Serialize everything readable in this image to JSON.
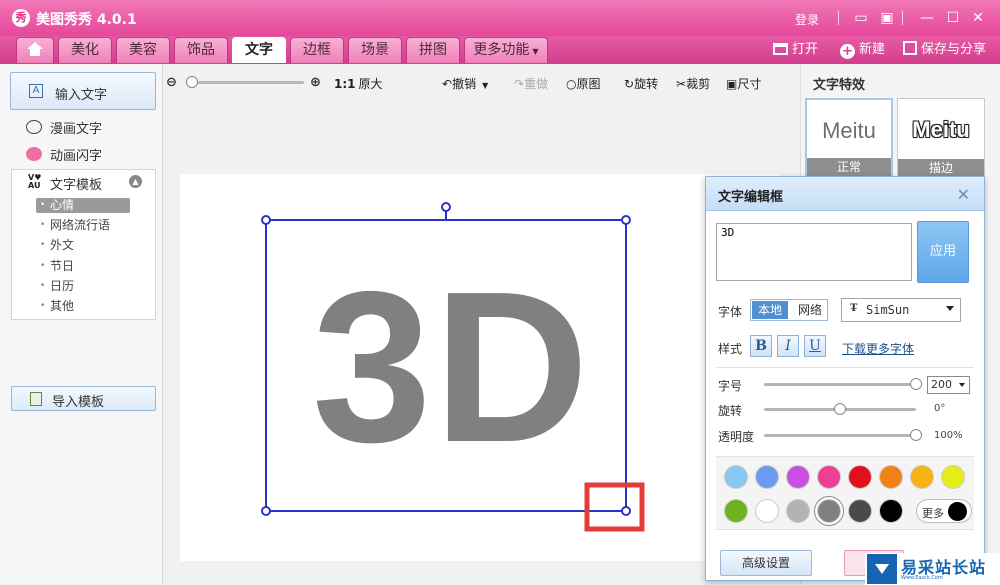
{
  "app": {
    "title": "美图秀秀 4.0.1",
    "logo_text": "秀",
    "login": "登录"
  },
  "titlebar": {
    "feedback_icon": "chat-icon",
    "skin_icon": "skin-icon"
  },
  "tabs": [
    {
      "label": "",
      "icon": "home-icon"
    },
    {
      "label": "美化"
    },
    {
      "label": "美容"
    },
    {
      "label": "饰品"
    },
    {
      "label": "文字",
      "active": true
    },
    {
      "label": "边框"
    },
    {
      "label": "场景"
    },
    {
      "label": "拼图"
    },
    {
      "label": "更多功能"
    }
  ],
  "menu_right": {
    "open": "打开",
    "new": "新建",
    "save": "保存与分享"
  },
  "left_panel": {
    "input_text": "输入文字",
    "comic_text": "漫画文字",
    "animated_text": "动画闪字",
    "template_header": "文字模板",
    "template_items": [
      "心情",
      "网络流行语",
      "外文",
      "节日",
      "日历",
      "其他"
    ],
    "selected_template": "心情",
    "import_template": "导入模板"
  },
  "toolbar": {
    "actual_size_key": "1:1",
    "actual_size": "原大",
    "undo": "撤销",
    "redo": "重做",
    "original": "原图",
    "rotate": "旋转",
    "crop": "裁剪",
    "resize": "尺寸"
  },
  "canvas": {
    "text": "3D"
  },
  "effects": {
    "title": "文字特效",
    "cards": [
      {
        "sample": "Meitu",
        "label": "正常",
        "active": true
      },
      {
        "sample": "Meitu",
        "label": "描边",
        "active": false
      }
    ]
  },
  "editor": {
    "title": "文字编辑框",
    "text_value": "3D",
    "apply": "应用",
    "font_label": "字体",
    "font_local": "本地",
    "font_web": "网络",
    "font_name": "SimSun",
    "style_label": "样式",
    "bold": "B",
    "italic": "I",
    "underline": "U",
    "download_fonts": "下载更多字体",
    "size_label": "字号",
    "size_value": "200",
    "rotate_label": "旋转",
    "rotate_value": "0°",
    "opacity_label": "透明度",
    "opacity_value": "100%",
    "more_colors": "更多",
    "advanced": "高级设置",
    "colors_row1": [
      "#87c7f2",
      "#6a9bef",
      "#c94fe3",
      "#ee3f93",
      "#e2101c",
      "#f08118",
      "#f5b413",
      "#e5ec18"
    ],
    "colors_row2": [
      "#6bb41e",
      "#ffffff",
      "#b3b3b3",
      "#808080",
      "#4a4a4a",
      "#000000"
    ],
    "selected_color": "#808080",
    "slider_levels": {
      "size": 1.0,
      "rotate": 0.5,
      "opacity": 1.0
    }
  },
  "watermark": {
    "text": "易采站长站",
    "sub": "Www.Easck.Com"
  }
}
